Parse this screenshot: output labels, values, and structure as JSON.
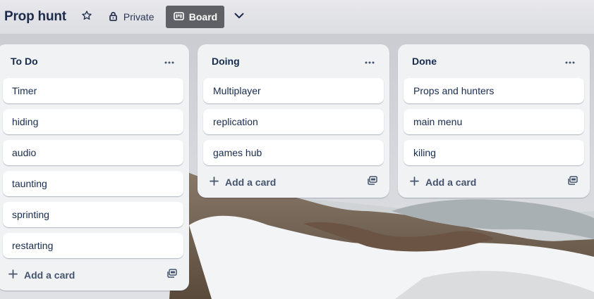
{
  "header": {
    "board_title": "Prop hunt",
    "visibility_label": "Private",
    "view_label": "Board",
    "icons": {
      "star": "star-icon",
      "visibility": "lock-icon",
      "view": "board-icon",
      "view_switcher": "chevron-down-icon"
    }
  },
  "lists": [
    {
      "title": "To Do",
      "cards": [
        "Timer",
        "hiding",
        "audio",
        "taunting",
        "sprinting",
        "restarting"
      ],
      "add_card_label": "Add a card"
    },
    {
      "title": "Doing",
      "cards": [
        "Multiplayer",
        "replication",
        "games hub"
      ],
      "add_card_label": "Add a card"
    },
    {
      "title": "Done",
      "cards": [
        "Props and hunters",
        "main menu",
        "kiling"
      ],
      "add_card_label": "Add a card"
    }
  ],
  "colors": {
    "header_text": "#1d2b4a",
    "view_button_bg": "#5f6066",
    "list_bg": "#f1f2f4",
    "card_bg": "#ffffff",
    "card_text": "#172b4d"
  }
}
